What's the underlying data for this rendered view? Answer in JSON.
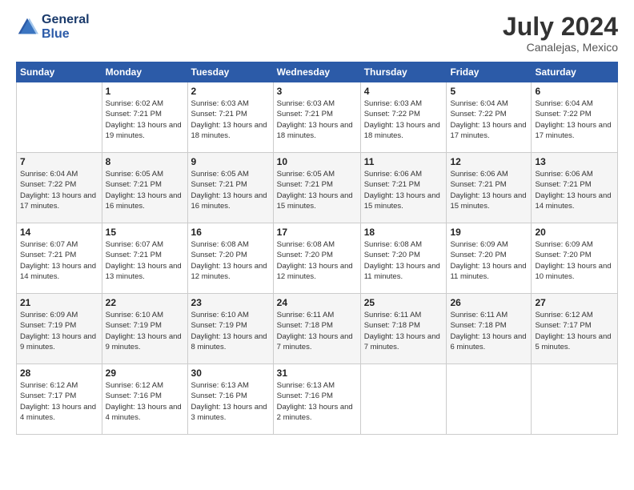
{
  "header": {
    "logo_line1": "General",
    "logo_line2": "Blue",
    "month_year": "July 2024",
    "location": "Canalejas, Mexico"
  },
  "calendar": {
    "days_of_week": [
      "Sunday",
      "Monday",
      "Tuesday",
      "Wednesday",
      "Thursday",
      "Friday",
      "Saturday"
    ],
    "weeks": [
      [
        {
          "day": "",
          "sunrise": "",
          "sunset": "",
          "daylight": ""
        },
        {
          "day": "1",
          "sunrise": "Sunrise: 6:02 AM",
          "sunset": "Sunset: 7:21 PM",
          "daylight": "Daylight: 13 hours and 19 minutes."
        },
        {
          "day": "2",
          "sunrise": "Sunrise: 6:03 AM",
          "sunset": "Sunset: 7:21 PM",
          "daylight": "Daylight: 13 hours and 18 minutes."
        },
        {
          "day": "3",
          "sunrise": "Sunrise: 6:03 AM",
          "sunset": "Sunset: 7:21 PM",
          "daylight": "Daylight: 13 hours and 18 minutes."
        },
        {
          "day": "4",
          "sunrise": "Sunrise: 6:03 AM",
          "sunset": "Sunset: 7:22 PM",
          "daylight": "Daylight: 13 hours and 18 minutes."
        },
        {
          "day": "5",
          "sunrise": "Sunrise: 6:04 AM",
          "sunset": "Sunset: 7:22 PM",
          "daylight": "Daylight: 13 hours and 17 minutes."
        },
        {
          "day": "6",
          "sunrise": "Sunrise: 6:04 AM",
          "sunset": "Sunset: 7:22 PM",
          "daylight": "Daylight: 13 hours and 17 minutes."
        }
      ],
      [
        {
          "day": "7",
          "sunrise": "Sunrise: 6:04 AM",
          "sunset": "Sunset: 7:22 PM",
          "daylight": "Daylight: 13 hours and 17 minutes."
        },
        {
          "day": "8",
          "sunrise": "Sunrise: 6:05 AM",
          "sunset": "Sunset: 7:21 PM",
          "daylight": "Daylight: 13 hours and 16 minutes."
        },
        {
          "day": "9",
          "sunrise": "Sunrise: 6:05 AM",
          "sunset": "Sunset: 7:21 PM",
          "daylight": "Daylight: 13 hours and 16 minutes."
        },
        {
          "day": "10",
          "sunrise": "Sunrise: 6:05 AM",
          "sunset": "Sunset: 7:21 PM",
          "daylight": "Daylight: 13 hours and 15 minutes."
        },
        {
          "day": "11",
          "sunrise": "Sunrise: 6:06 AM",
          "sunset": "Sunset: 7:21 PM",
          "daylight": "Daylight: 13 hours and 15 minutes."
        },
        {
          "day": "12",
          "sunrise": "Sunrise: 6:06 AM",
          "sunset": "Sunset: 7:21 PM",
          "daylight": "Daylight: 13 hours and 15 minutes."
        },
        {
          "day": "13",
          "sunrise": "Sunrise: 6:06 AM",
          "sunset": "Sunset: 7:21 PM",
          "daylight": "Daylight: 13 hours and 14 minutes."
        }
      ],
      [
        {
          "day": "14",
          "sunrise": "Sunrise: 6:07 AM",
          "sunset": "Sunset: 7:21 PM",
          "daylight": "Daylight: 13 hours and 14 minutes."
        },
        {
          "day": "15",
          "sunrise": "Sunrise: 6:07 AM",
          "sunset": "Sunset: 7:21 PM",
          "daylight": "Daylight: 13 hours and 13 minutes."
        },
        {
          "day": "16",
          "sunrise": "Sunrise: 6:08 AM",
          "sunset": "Sunset: 7:20 PM",
          "daylight": "Daylight: 13 hours and 12 minutes."
        },
        {
          "day": "17",
          "sunrise": "Sunrise: 6:08 AM",
          "sunset": "Sunset: 7:20 PM",
          "daylight": "Daylight: 13 hours and 12 minutes."
        },
        {
          "day": "18",
          "sunrise": "Sunrise: 6:08 AM",
          "sunset": "Sunset: 7:20 PM",
          "daylight": "Daylight: 13 hours and 11 minutes."
        },
        {
          "day": "19",
          "sunrise": "Sunrise: 6:09 AM",
          "sunset": "Sunset: 7:20 PM",
          "daylight": "Daylight: 13 hours and 11 minutes."
        },
        {
          "day": "20",
          "sunrise": "Sunrise: 6:09 AM",
          "sunset": "Sunset: 7:20 PM",
          "daylight": "Daylight: 13 hours and 10 minutes."
        }
      ],
      [
        {
          "day": "21",
          "sunrise": "Sunrise: 6:09 AM",
          "sunset": "Sunset: 7:19 PM",
          "daylight": "Daylight: 13 hours and 9 minutes."
        },
        {
          "day": "22",
          "sunrise": "Sunrise: 6:10 AM",
          "sunset": "Sunset: 7:19 PM",
          "daylight": "Daylight: 13 hours and 9 minutes."
        },
        {
          "day": "23",
          "sunrise": "Sunrise: 6:10 AM",
          "sunset": "Sunset: 7:19 PM",
          "daylight": "Daylight: 13 hours and 8 minutes."
        },
        {
          "day": "24",
          "sunrise": "Sunrise: 6:11 AM",
          "sunset": "Sunset: 7:18 PM",
          "daylight": "Daylight: 13 hours and 7 minutes."
        },
        {
          "day": "25",
          "sunrise": "Sunrise: 6:11 AM",
          "sunset": "Sunset: 7:18 PM",
          "daylight": "Daylight: 13 hours and 7 minutes."
        },
        {
          "day": "26",
          "sunrise": "Sunrise: 6:11 AM",
          "sunset": "Sunset: 7:18 PM",
          "daylight": "Daylight: 13 hours and 6 minutes."
        },
        {
          "day": "27",
          "sunrise": "Sunrise: 6:12 AM",
          "sunset": "Sunset: 7:17 PM",
          "daylight": "Daylight: 13 hours and 5 minutes."
        }
      ],
      [
        {
          "day": "28",
          "sunrise": "Sunrise: 6:12 AM",
          "sunset": "Sunset: 7:17 PM",
          "daylight": "Daylight: 13 hours and 4 minutes."
        },
        {
          "day": "29",
          "sunrise": "Sunrise: 6:12 AM",
          "sunset": "Sunset: 7:16 PM",
          "daylight": "Daylight: 13 hours and 4 minutes."
        },
        {
          "day": "30",
          "sunrise": "Sunrise: 6:13 AM",
          "sunset": "Sunset: 7:16 PM",
          "daylight": "Daylight: 13 hours and 3 minutes."
        },
        {
          "day": "31",
          "sunrise": "Sunrise: 6:13 AM",
          "sunset": "Sunset: 7:16 PM",
          "daylight": "Daylight: 13 hours and 2 minutes."
        },
        {
          "day": "",
          "sunrise": "",
          "sunset": "",
          "daylight": ""
        },
        {
          "day": "",
          "sunrise": "",
          "sunset": "",
          "daylight": ""
        },
        {
          "day": "",
          "sunrise": "",
          "sunset": "",
          "daylight": ""
        }
      ]
    ]
  }
}
